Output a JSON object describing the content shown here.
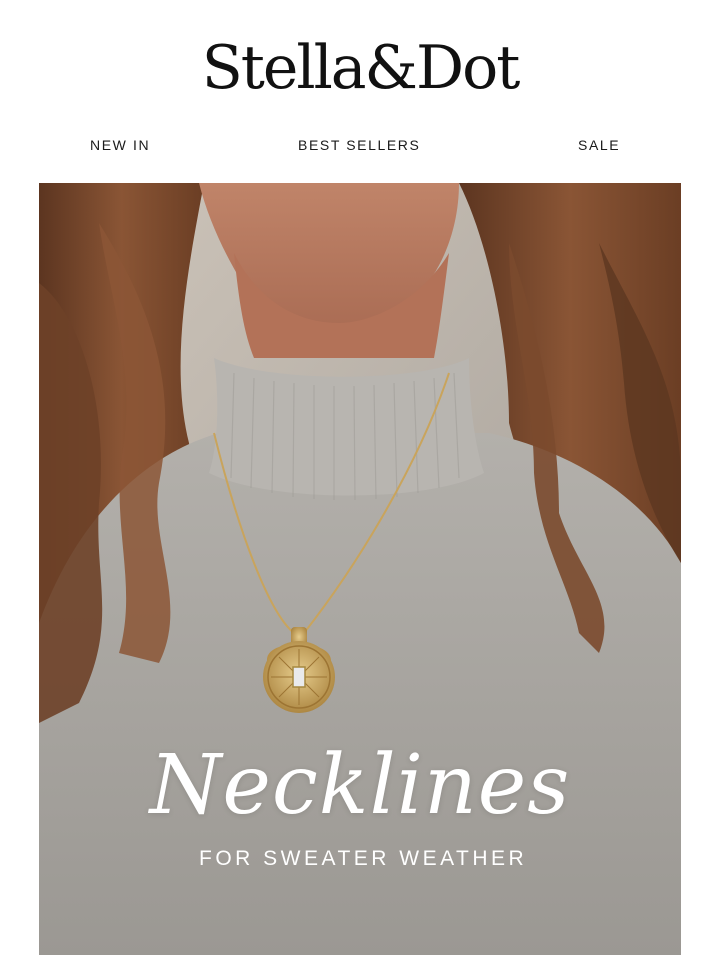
{
  "brand": {
    "name": "Stella&Dot"
  },
  "nav": {
    "items": [
      {
        "label": "NEW IN"
      },
      {
        "label": "BEST SELLERS"
      },
      {
        "label": "SALE"
      }
    ]
  },
  "hero": {
    "title": "Necklines",
    "subtitle": "FOR SWEATER WEATHER"
  },
  "colors": {
    "text": "#111111",
    "sweater": "#aaa7a2",
    "hair": "#7a4a2c",
    "gold": "#c9a45c"
  }
}
